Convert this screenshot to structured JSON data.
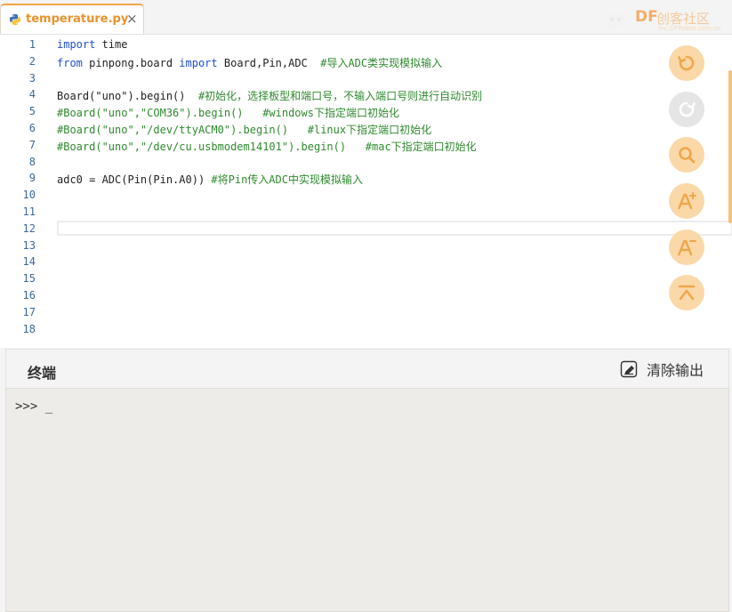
{
  "tab": {
    "title": "temperature.py",
    "close": "×",
    "icon": "python-icon"
  },
  "logo": {
    "brand": "DF",
    "name": "创客社区",
    "url": "mc.DFRobot.com.cn"
  },
  "editor": {
    "line_numbers": [
      "1",
      "2",
      "3",
      "4",
      "5",
      "6",
      "7",
      "8",
      "9",
      "10",
      "11",
      "12",
      "13",
      "14",
      "15",
      "16",
      "17",
      "18"
    ],
    "lines": [
      [
        {
          "t": "import",
          "c": "kw"
        },
        {
          "t": " time",
          "c": ""
        }
      ],
      [
        {
          "t": "from",
          "c": "kw"
        },
        {
          "t": " pinpong.board ",
          "c": ""
        },
        {
          "t": "import",
          "c": "kw"
        },
        {
          "t": " Board,Pin,ADC  ",
          "c": ""
        },
        {
          "t": "#导入ADC类实现模拟输入",
          "c": "cm"
        }
      ],
      [],
      [
        {
          "t": "Board(\"uno\").begin()  ",
          "c": ""
        },
        {
          "t": "#初始化，选择板型和端口号，不输入端口号则进行自动识别",
          "c": "cm"
        }
      ],
      [
        {
          "t": "#Board(\"uno\",\"COM36\").begin()   #windows下指定端口初始化",
          "c": "cm"
        }
      ],
      [
        {
          "t": "#Board(\"uno\",\"/dev/ttyACM0\").begin()   #linux下指定端口初始化",
          "c": "cm"
        }
      ],
      [
        {
          "t": "#Board(\"uno\",\"/dev/cu.usbmodem14101\").begin()   #mac下指定端口初始化",
          "c": "cm"
        }
      ],
      [],
      [
        {
          "t": "adc0 = ADC(Pin(Pin.A0)) ",
          "c": ""
        },
        {
          "t": "#将Pin传入ADC中实现模拟输入",
          "c": "cm"
        }
      ]
    ]
  },
  "toolbar": {
    "undo": "undo-icon",
    "redo": "redo-icon",
    "search": "search-icon",
    "font_increase": "font-increase-icon",
    "font_decrease": "font-decrease-icon",
    "scroll_top": "scroll-top-icon"
  },
  "terminal": {
    "title": "终端",
    "clear_label": "清除输出",
    "prompt": ">>> _"
  },
  "colors": {
    "accent": "#f0a64a",
    "keyword": "#1f4fd1",
    "comment": "#2f8a2f",
    "tool_bg": "#fbd8a8"
  }
}
